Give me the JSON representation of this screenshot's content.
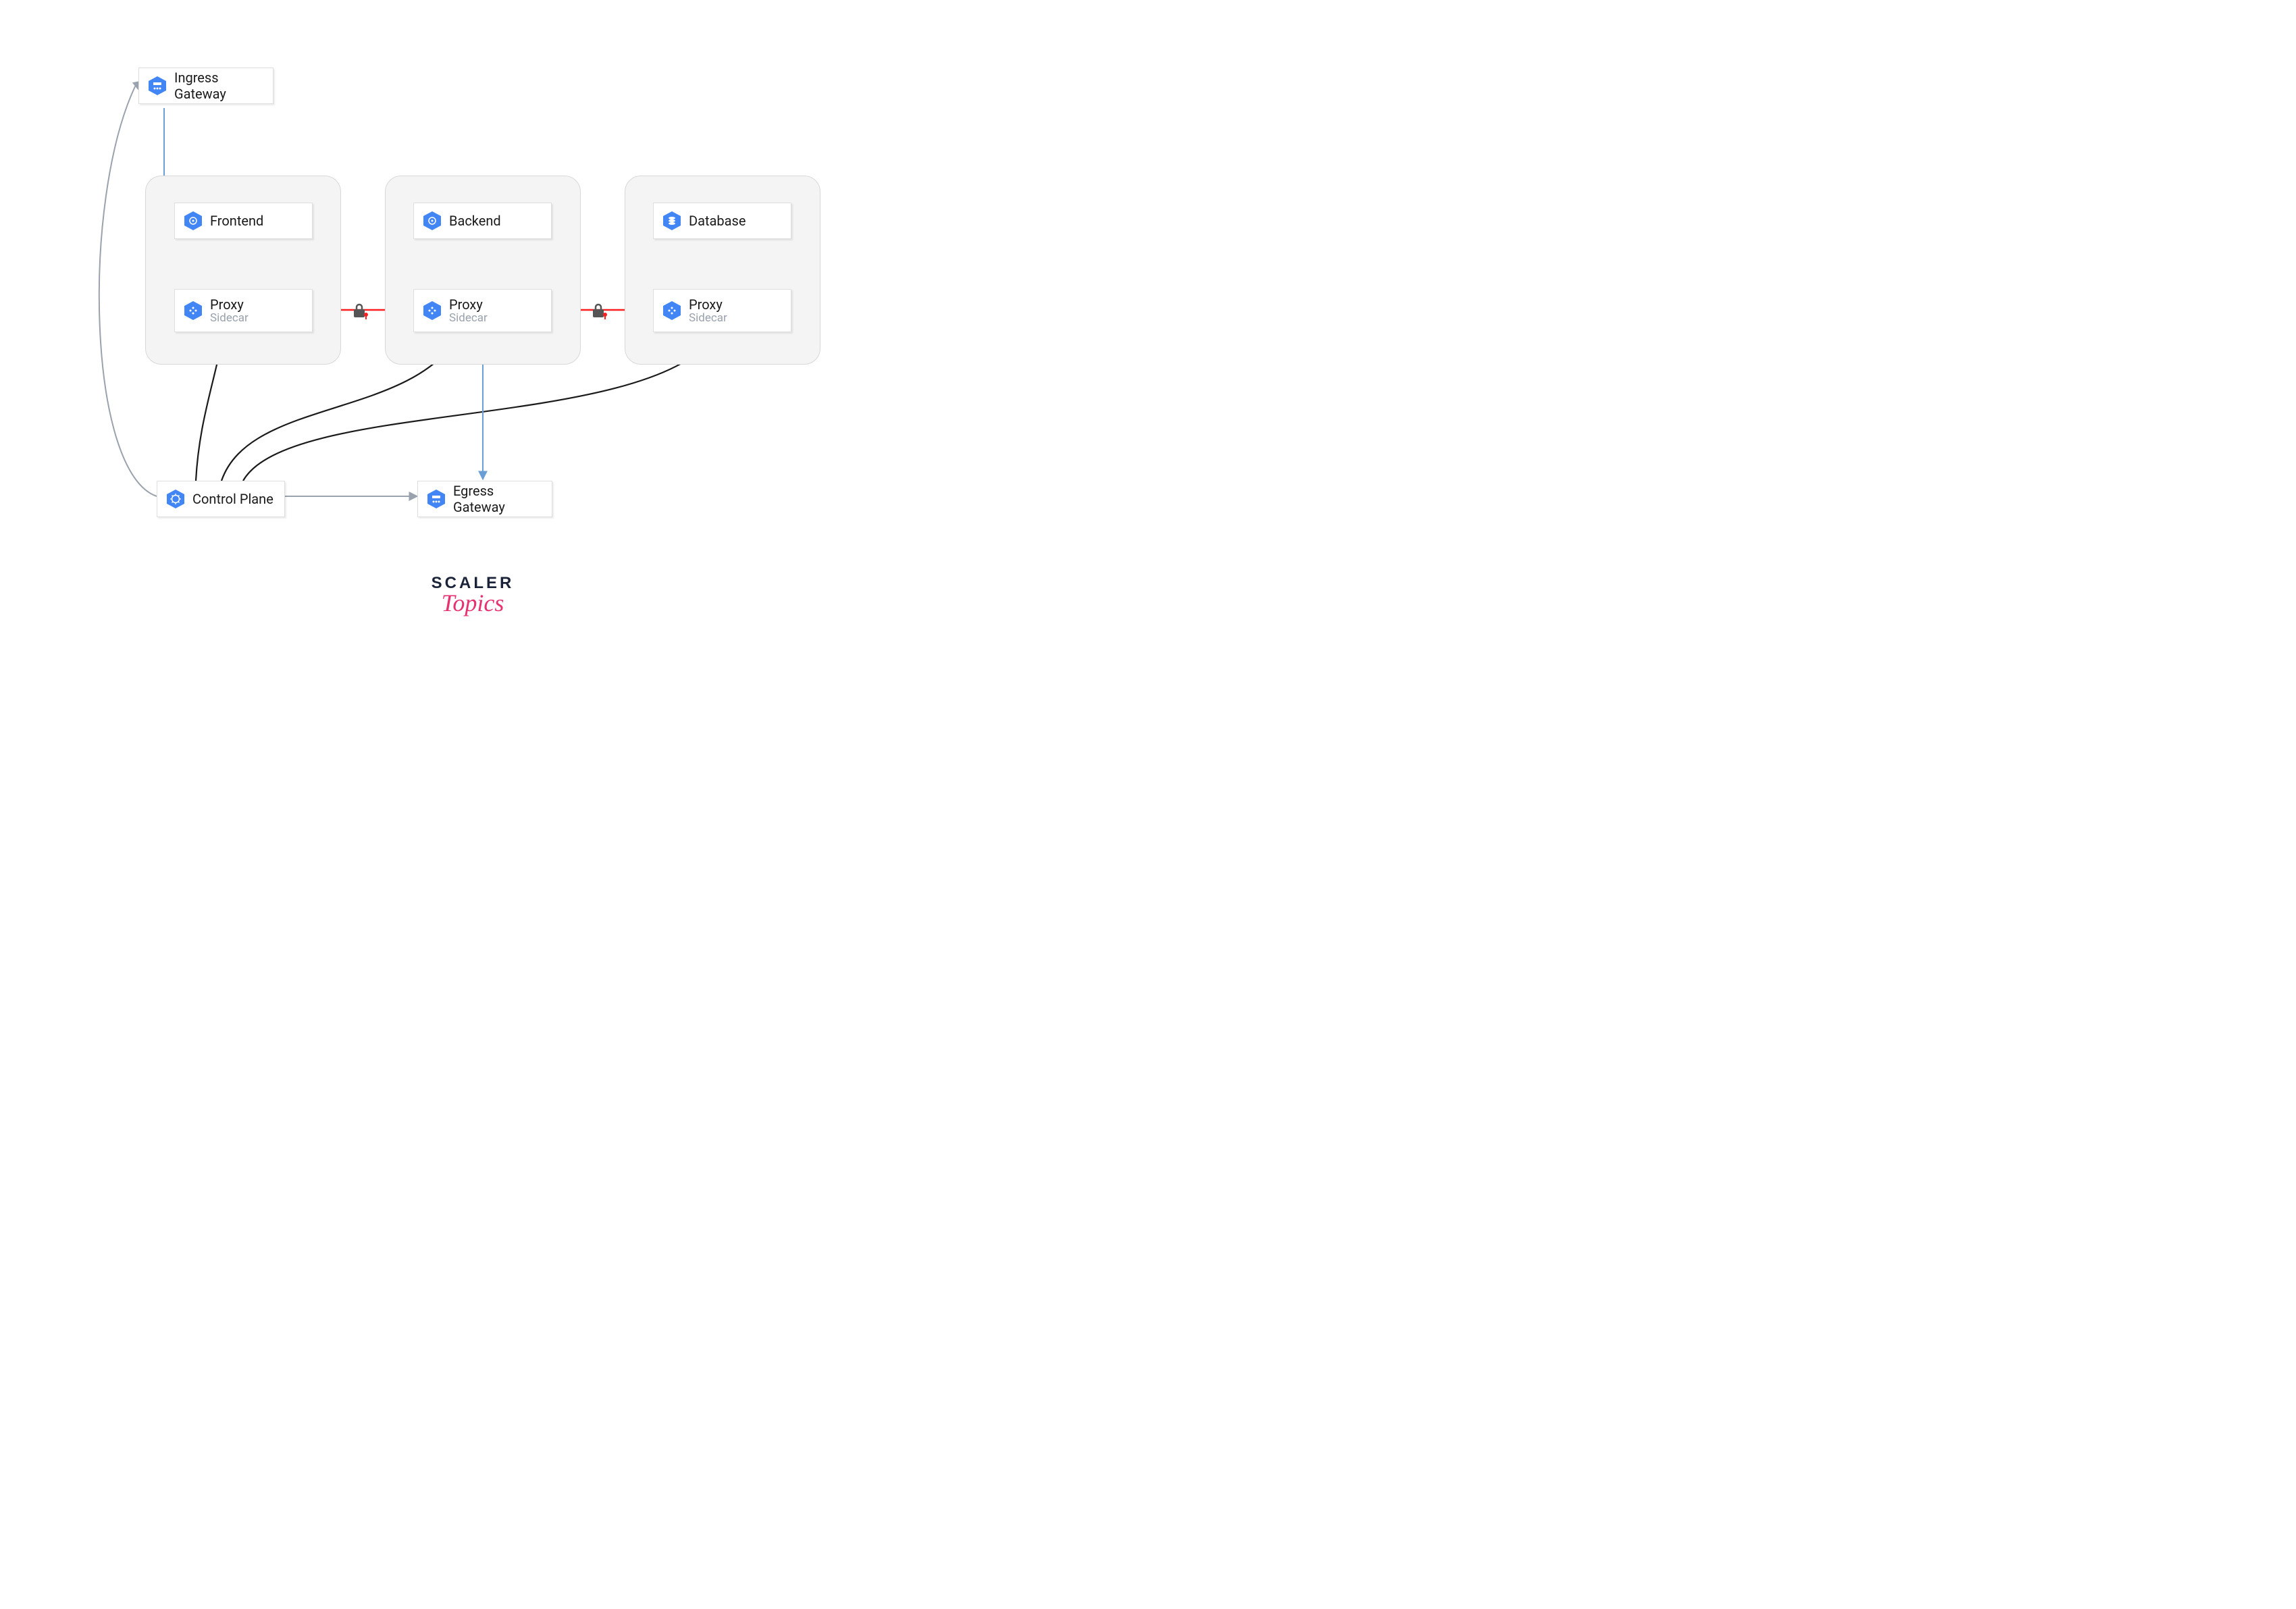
{
  "nodes": {
    "ingress": {
      "label": "Ingress Gateway"
    },
    "egress": {
      "label": "Egress Gateway"
    },
    "control": {
      "label": "Control Plane"
    },
    "frontend": {
      "label": "Frontend"
    },
    "backend": {
      "label": "Backend"
    },
    "database": {
      "label": "Database"
    },
    "proxy1": {
      "label": "Proxy",
      "sublabel": "Sidecar"
    },
    "proxy2": {
      "label": "Proxy",
      "sublabel": "Sidecar"
    },
    "proxy3": {
      "label": "Proxy",
      "sublabel": "Sidecar"
    }
  },
  "edges": [
    {
      "from": "ingress",
      "to": "proxy1",
      "style": "blue"
    },
    {
      "from": "proxy1",
      "to": "proxy2",
      "style": "red-encrypted"
    },
    {
      "from": "proxy2",
      "to": "proxy3",
      "style": "red-encrypted"
    },
    {
      "from": "frontend",
      "to": "proxy1",
      "style": "green-bidir"
    },
    {
      "from": "backend",
      "to": "proxy2",
      "style": "green-bidir"
    },
    {
      "from": "database",
      "to": "proxy3",
      "style": "green-bidir"
    },
    {
      "from": "control",
      "to": "ingress",
      "style": "grey"
    },
    {
      "from": "control",
      "to": "egress",
      "style": "grey"
    },
    {
      "from": "control",
      "to": "proxy1",
      "style": "black"
    },
    {
      "from": "control",
      "to": "proxy2",
      "style": "black"
    },
    {
      "from": "control",
      "to": "proxy3",
      "style": "black"
    },
    {
      "from": "proxy2",
      "to": "egress",
      "style": "blue"
    }
  ],
  "branding": {
    "top": "SCALER",
    "bottom": "Topics"
  },
  "colors": {
    "hex": "#4285f4",
    "red": "#ff1f1f",
    "green": "#7bc86c",
    "blue": "#6a9ed4",
    "grey": "#9aa2ad",
    "black": "#1a1a1a"
  }
}
